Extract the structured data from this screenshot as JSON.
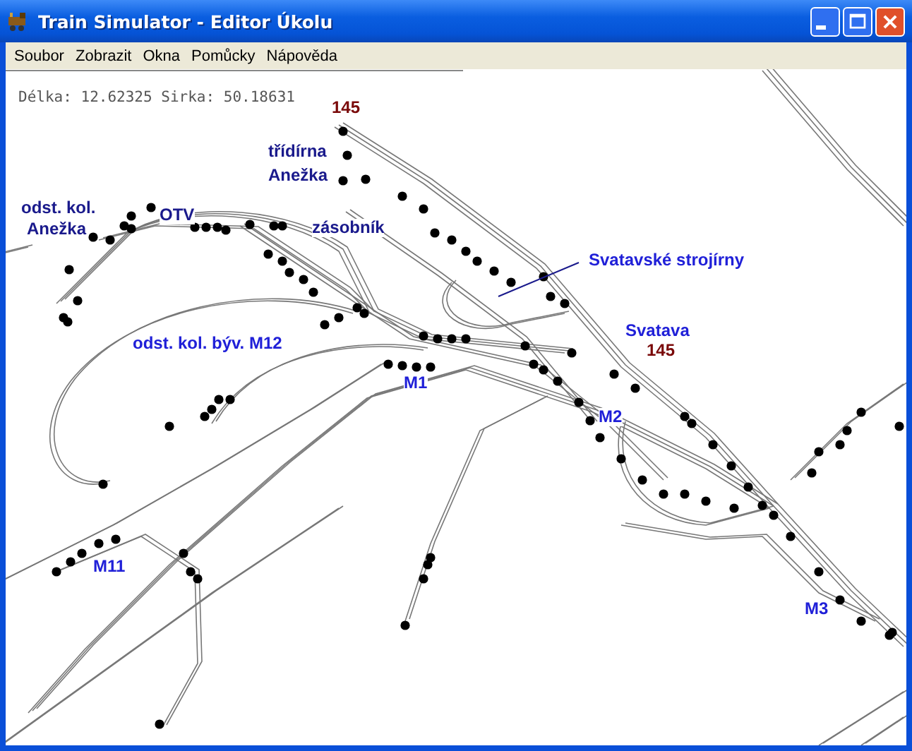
{
  "window": {
    "title": "Train Simulator - Editor Úkolu"
  },
  "menu": [
    "Soubor",
    "Zobrazit",
    "Okna",
    "Pomůcky",
    "Nápověda"
  ],
  "coordinates": "Délka: 12.62325 Sirka: 50.18631",
  "labels": [
    {
      "text": "145",
      "kind": "km"
    },
    {
      "text": "třídírna",
      "kind": "place"
    },
    {
      "text": "Anežka",
      "kind": "place"
    },
    {
      "text": "odst. kol.",
      "kind": "place"
    },
    {
      "text": "Anežka",
      "kind": "place"
    },
    {
      "text": "OTV",
      "kind": "place"
    },
    {
      "text": "zásobník",
      "kind": "place"
    },
    {
      "text": "Svatavské strojírny",
      "kind": "track"
    },
    {
      "text": "odst. kol. býv. M12",
      "kind": "track"
    },
    {
      "text": "Svatava",
      "kind": "track"
    },
    {
      "text": "145",
      "kind": "km"
    },
    {
      "text": "M1",
      "kind": "track"
    },
    {
      "text": "M2",
      "kind": "track"
    },
    {
      "text": "M11",
      "kind": "track"
    },
    {
      "text": "M3",
      "kind": "track"
    }
  ]
}
